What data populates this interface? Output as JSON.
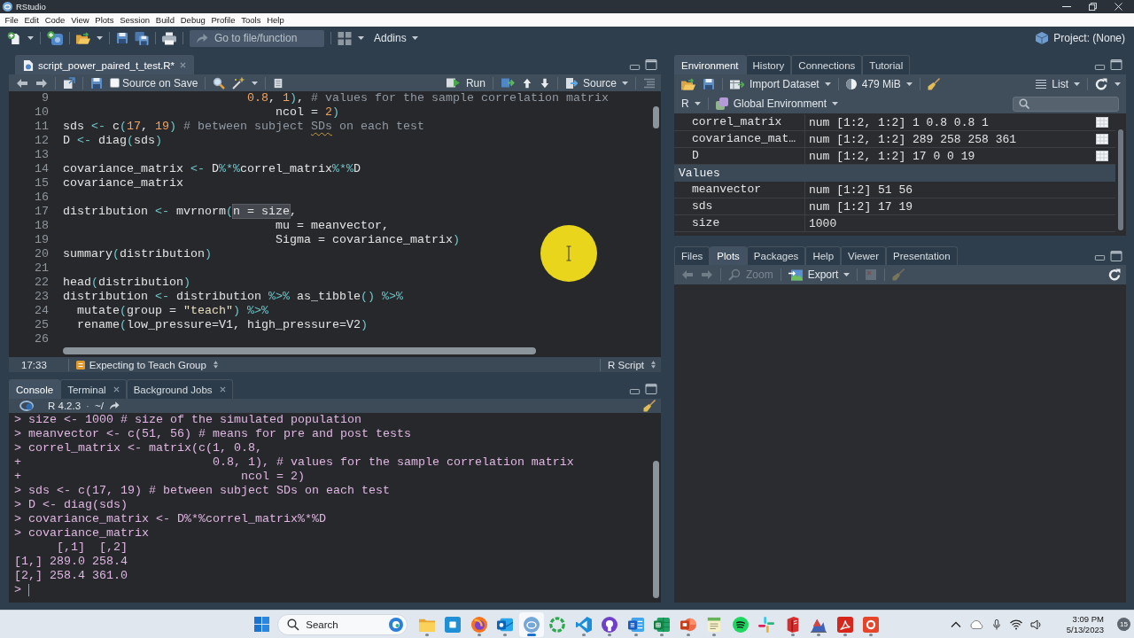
{
  "window": {
    "title": "RStudio"
  },
  "menu": [
    "File",
    "Edit",
    "Code",
    "View",
    "Plots",
    "Session",
    "Build",
    "Debug",
    "Profile",
    "Tools",
    "Help"
  ],
  "toolbar": {
    "goto_placeholder": "Go to file/function",
    "addins": "Addins",
    "project": "Project: (None)"
  },
  "editor": {
    "tabs": [
      {
        "label": "script_power_paired_t_test.R*",
        "selected": true,
        "closable": true
      }
    ],
    "source_on_save": {
      "label": "Source on Save",
      "checked": false
    },
    "run": "Run",
    "source": "Source",
    "lines": [
      {
        "number": "9",
        "segments": [
          {
            "text": "                          0.8",
            "kind": "number"
          },
          {
            "text": ", ",
            "kind": "plain"
          },
          {
            "text": "1",
            "kind": "number"
          },
          {
            "text": ")",
            "kind": "operator"
          },
          {
            "text": ", ",
            "kind": "plain"
          },
          {
            "text": "# values for the sample correlation matrix",
            "kind": "comment"
          }
        ]
      },
      {
        "number": "10",
        "segments": [
          {
            "text": "                              ncol = ",
            "kind": "plain"
          },
          {
            "text": "2",
            "kind": "number"
          },
          {
            "text": ")",
            "kind": "operator"
          }
        ]
      },
      {
        "number": "11",
        "segments": [
          {
            "text": "sds ",
            "kind": "plain"
          },
          {
            "text": "<-",
            "kind": "operator"
          },
          {
            "text": " c",
            "kind": "plain"
          },
          {
            "text": "(",
            "kind": "operator"
          },
          {
            "text": "17",
            "kind": "number"
          },
          {
            "text": ", ",
            "kind": "plain"
          },
          {
            "text": "19",
            "kind": "number"
          },
          {
            "text": ")",
            "kind": "operator"
          },
          {
            "text": " # between subject ",
            "kind": "comment"
          },
          {
            "text": "SDs",
            "kind": "misspelled"
          },
          {
            "text": " on each test",
            "kind": "comment"
          }
        ]
      },
      {
        "number": "12",
        "segments": [
          {
            "text": "D ",
            "kind": "plain"
          },
          {
            "text": "<-",
            "kind": "operator"
          },
          {
            "text": " diag",
            "kind": "plain"
          },
          {
            "text": "(",
            "kind": "operator"
          },
          {
            "text": "sds",
            "kind": "plain"
          },
          {
            "text": ")",
            "kind": "operator"
          }
        ]
      },
      {
        "number": "13"
      },
      {
        "number": "14",
        "segments": [
          {
            "text": "covariance_matrix ",
            "kind": "plain"
          },
          {
            "text": "<-",
            "kind": "operator"
          },
          {
            "text": " D",
            "kind": "plain"
          },
          {
            "text": "%*%",
            "kind": "operator"
          },
          {
            "text": "correl_matrix",
            "kind": "plain"
          },
          {
            "text": "%*%",
            "kind": "operator"
          },
          {
            "text": "D",
            "kind": "plain"
          }
        ]
      },
      {
        "number": "15",
        "segments": [
          {
            "text": "covariance_matrix",
            "kind": "plain"
          }
        ]
      },
      {
        "number": "16"
      },
      {
        "number": "17",
        "segments": [
          {
            "text": "distribution ",
            "kind": "plain"
          },
          {
            "text": "<-",
            "kind": "operator"
          },
          {
            "text": " mvrnorm",
            "kind": "plain"
          },
          {
            "text": "(",
            "kind": "operator"
          },
          {
            "text": "n = size",
            "kind": "match"
          },
          {
            "text": ",",
            "kind": "plain"
          }
        ]
      },
      {
        "number": "18",
        "segments": [
          {
            "text": "                              mu = meanvector,",
            "kind": "plain"
          }
        ]
      },
      {
        "number": "19",
        "segments": [
          {
            "text": "                              Sigma = covariance_matrix",
            "kind": "plain"
          },
          {
            "text": ")",
            "kind": "operator"
          }
        ]
      },
      {
        "number": "20",
        "segments": [
          {
            "text": "summary",
            "kind": "plain"
          },
          {
            "text": "(",
            "kind": "operator"
          },
          {
            "text": "distribution",
            "kind": "plain"
          },
          {
            "text": ")",
            "kind": "operator"
          }
        ]
      },
      {
        "number": "21"
      },
      {
        "number": "22",
        "segments": [
          {
            "text": "head",
            "kind": "plain"
          },
          {
            "text": "(",
            "kind": "operator"
          },
          {
            "text": "distribution",
            "kind": "plain"
          },
          {
            "text": ")",
            "kind": "operator"
          }
        ]
      },
      {
        "number": "23",
        "segments": [
          {
            "text": "distribution ",
            "kind": "plain"
          },
          {
            "text": "<-",
            "kind": "operator"
          },
          {
            "text": " distribution ",
            "kind": "plain"
          },
          {
            "text": "%>%",
            "kind": "operator"
          },
          {
            "text": " as_tibble",
            "kind": "plain"
          },
          {
            "text": "() %>%",
            "kind": "operator"
          }
        ]
      },
      {
        "number": "24",
        "segments": [
          {
            "text": "  mutate",
            "kind": "plain"
          },
          {
            "text": "(",
            "kind": "operator"
          },
          {
            "text": "group = ",
            "kind": "plain"
          },
          {
            "text": "\"teach\"",
            "kind": "string"
          },
          {
            "text": ") %>%",
            "kind": "operator"
          }
        ]
      },
      {
        "number": "25",
        "segments": [
          {
            "text": "  rename",
            "kind": "plain"
          },
          {
            "text": "(",
            "kind": "operator"
          },
          {
            "text": "low_pressure=V1, high_pressure=V2",
            "kind": "plain"
          },
          {
            "text": ")",
            "kind": "operator"
          }
        ]
      },
      {
        "number": "26"
      }
    ],
    "status": {
      "position": "17:33",
      "scope": "Expecting to Teach Group",
      "file_type": "R Script"
    }
  },
  "console": {
    "tabs": [
      {
        "label": "Console",
        "selected": true,
        "closable": false
      },
      {
        "label": "Terminal",
        "selected": false,
        "closable": true
      },
      {
        "label": "Background Jobs",
        "selected": false,
        "closable": true
      }
    ],
    "version": "R 4.2.3",
    "separator": "·",
    "path": "~/",
    "lines": [
      {
        "prompt": ">",
        "text": "size <- 1000 # size of the simulated population"
      },
      {
        "prompt": ">",
        "text": "meanvector <- c(51, 56) # means for pre and post tests"
      },
      {
        "prompt": ">",
        "text": "correl_matrix <- matrix(c(1, 0.8,"
      },
      {
        "prompt": "+",
        "text": "                          0.8, 1), # values for the sample correlation matrix"
      },
      {
        "prompt": "+",
        "text": "                              ncol = 2)"
      },
      {
        "prompt": ">",
        "text": "sds <- c(17, 19) # between subject SDs on each test"
      },
      {
        "prompt": ">",
        "text": "D <- diag(sds)"
      },
      {
        "prompt": ">",
        "text": "covariance_matrix <- D%*%correl_matrix%*%D"
      },
      {
        "prompt": ">",
        "text": "covariance_matrix"
      },
      {
        "text": "      [,1]  [,2]"
      },
      {
        "text": "[1,] 289.0 258.4"
      },
      {
        "text": "[2,] 258.4 361.0"
      },
      {
        "prompt": ">",
        "cursor": true
      }
    ]
  },
  "environment": {
    "tabs": [
      {
        "label": "Environment",
        "selected": true
      },
      {
        "label": "History",
        "selected": false
      },
      {
        "label": "Connections",
        "selected": false
      },
      {
        "label": "Tutorial",
        "selected": false
      }
    ],
    "import": "Import Dataset",
    "memory": "479 MiB",
    "view": "List",
    "language": "R",
    "scope": "Global Environment",
    "rows": [
      {
        "kind": "object",
        "name": "correl_matrix",
        "value": "num [1:2, 1:2] 1 0.8 0.8 1"
      },
      {
        "kind": "object",
        "name": "covariance_mat…",
        "value": "num [1:2, 1:2] 289 258 258 361"
      },
      {
        "kind": "object",
        "name": "D",
        "value": "num [1:2, 1:2] 17 0 0 19"
      },
      {
        "kind": "section",
        "name": "Values"
      },
      {
        "kind": "value",
        "name": "meanvector",
        "value": "num [1:2] 51 56"
      },
      {
        "kind": "value",
        "name": "sds",
        "value": "num [1:2] 17 19"
      },
      {
        "kind": "value",
        "name": "size",
        "value": "1000"
      }
    ]
  },
  "files": {
    "tabs": [
      {
        "label": "Files",
        "selected": false
      },
      {
        "label": "Plots",
        "selected": true
      },
      {
        "label": "Packages",
        "selected": false
      },
      {
        "label": "Help",
        "selected": false
      },
      {
        "label": "Viewer",
        "selected": false
      },
      {
        "label": "Presentation",
        "selected": false
      }
    ],
    "tools": [
      {
        "kind": "back",
        "disabled": true
      },
      {
        "kind": "forward",
        "disabled": true
      },
      {
        "kind": "zoom",
        "label": "Zoom",
        "disabled": true
      },
      {
        "kind": "export",
        "label": "Export",
        "disabled": false
      },
      {
        "kind": "delete",
        "disabled": true
      },
      {
        "kind": "clear",
        "disabled": true
      }
    ]
  },
  "taskbar": {
    "search_placeholder": "Search",
    "apps": [
      {
        "kind": "folder",
        "running": true,
        "selected": false
      },
      {
        "kind": "launcher",
        "running": false,
        "selected": false
      },
      {
        "kind": "globe",
        "running": true,
        "selected": false
      },
      {
        "kind": "mail",
        "running": true,
        "selected": false
      },
      {
        "kind": "rlogo",
        "running": true,
        "selected": true
      },
      {
        "kind": "ring",
        "running": false,
        "selected": false
      },
      {
        "kind": "code",
        "running": true,
        "selected": false
      },
      {
        "kind": "octo",
        "running": true,
        "selected": false
      },
      {
        "kind": "document",
        "running": true,
        "selected": false
      },
      {
        "kind": "sheet",
        "running": true,
        "selected": false
      },
      {
        "kind": "slides",
        "running": true,
        "selected": false
      },
      {
        "kind": "notes",
        "running": true,
        "selected": false
      },
      {
        "kind": "music",
        "running": false,
        "selected": false
      },
      {
        "kind": "pinwheel",
        "running": false,
        "selected": false
      },
      {
        "kind": "book",
        "running": true,
        "selected": false
      },
      {
        "kind": "chart",
        "running": true,
        "selected": false
      },
      {
        "kind": "pdf",
        "running": true,
        "selected": false
      },
      {
        "kind": "tile",
        "running": true,
        "selected": false
      }
    ],
    "time": "3:09 PM",
    "date": "5/13/2023",
    "notifications": "15"
  }
}
